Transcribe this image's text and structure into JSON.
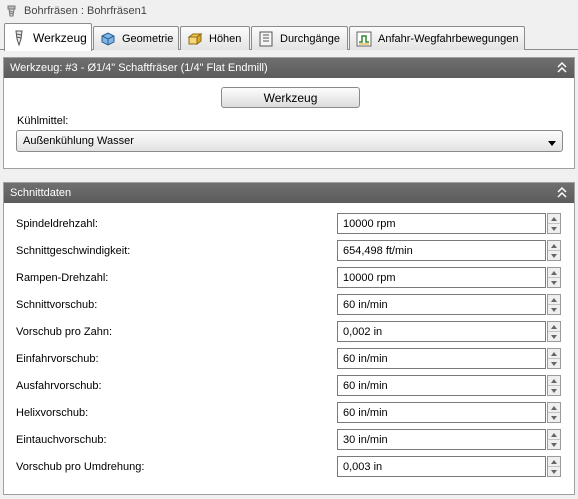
{
  "window": {
    "title": "Bohrfräsen : Bohrfräsen1"
  },
  "tabs": [
    {
      "label": "Werkzeug",
      "icon": "drill-bit-icon",
      "active": true
    },
    {
      "label": "Geometrie",
      "icon": "cube-icon",
      "active": false
    },
    {
      "label": "Höhen",
      "icon": "heights-icon",
      "active": false
    },
    {
      "label": "Durchgänge",
      "icon": "passes-icon",
      "active": false
    },
    {
      "label": "Anfahr-Wegfahrbewegungen",
      "icon": "linking-icon",
      "active": false
    }
  ],
  "tool_panel": {
    "header": "Werkzeug: #3 - Ø1/4\" Schaftfräser (1/4\" Flat Endmill)",
    "tool_button": "Werkzeug",
    "coolant_label": "Kühlmittel:",
    "coolant_value": "Außenkühlung Wasser"
  },
  "cut_panel": {
    "header": "Schnittdaten",
    "rows": [
      {
        "label": "Spindeldrehzahl:",
        "value": "10000 rpm"
      },
      {
        "label": "Schnittgeschwindigkeit:",
        "value": "654,498 ft/min"
      },
      {
        "label": "Rampen-Drehzahl:",
        "value": "10000 rpm"
      },
      {
        "label": "Schnittvorschub:",
        "value": "60 in/min"
      },
      {
        "label": "Vorschub pro Zahn:",
        "value": "0,002 in"
      },
      {
        "label": "Einfahrvorschub:",
        "value": "60 in/min"
      },
      {
        "label": "Ausfahrvorschub:",
        "value": "60 in/min"
      },
      {
        "label": "Helixvorschub:",
        "value": "60 in/min"
      },
      {
        "label": "Eintauchvorschub:",
        "value": "30 in/min"
      },
      {
        "label": "Vorschub pro Umdrehung:",
        "value": "0,003 in"
      }
    ]
  },
  "colors": {
    "panel_header": "#646464",
    "tab_border": "#8c8c8c"
  }
}
